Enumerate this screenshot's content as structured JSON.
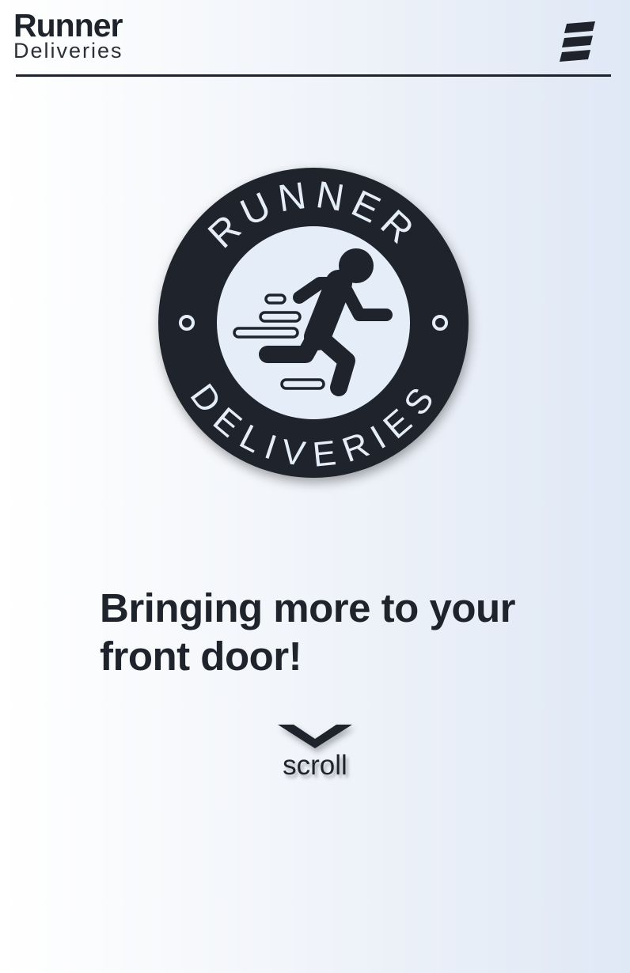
{
  "header": {
    "brand_main": "Runner",
    "brand_sub": "Deliveries",
    "menu_icon": "hamburger-menu-icon"
  },
  "logo": {
    "top_text": "RUNNER",
    "bottom_text": "DELIVERIES",
    "icon": "running-person-icon"
  },
  "hero": {
    "tagline": "Bringing more to your front door!"
  },
  "scroll": {
    "label": "scroll",
    "icon": "chevron-down-icon"
  },
  "colors": {
    "primary_dark": "#1f232b",
    "logo_inner": "#e4edf8",
    "background_start": "#ffffff",
    "background_end": "#dfe8f5"
  }
}
